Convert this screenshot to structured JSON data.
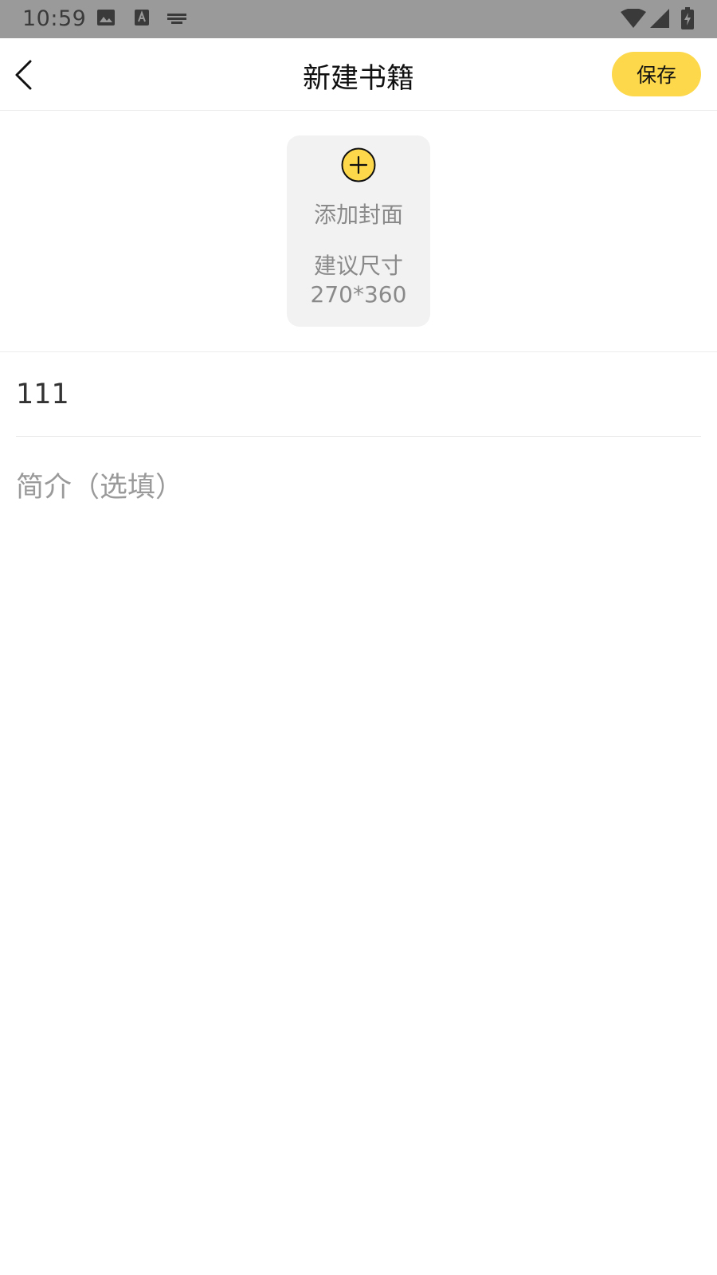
{
  "status_bar": {
    "time": "10:59",
    "icons": [
      "gallery-icon",
      "text-a-icon",
      "keyboard-icon",
      "wifi-icon",
      "signal-icon",
      "battery-charging-icon"
    ]
  },
  "header": {
    "back_icon": "chevron-left-icon",
    "title": "新建书籍",
    "save_label": "保存"
  },
  "cover": {
    "add_icon": "plus-circle-icon",
    "add_label": "添加封面",
    "hint": "建议尺寸",
    "size": "270*360"
  },
  "form": {
    "title_value": "111",
    "intro_placeholder": "简介（选填）",
    "intro_value": ""
  },
  "colors": {
    "accent": "#fcd84a",
    "status_bar_bg": "#9a9a9a",
    "card_bg": "#f2f2f2",
    "hint_text": "#8a8a8a"
  }
}
